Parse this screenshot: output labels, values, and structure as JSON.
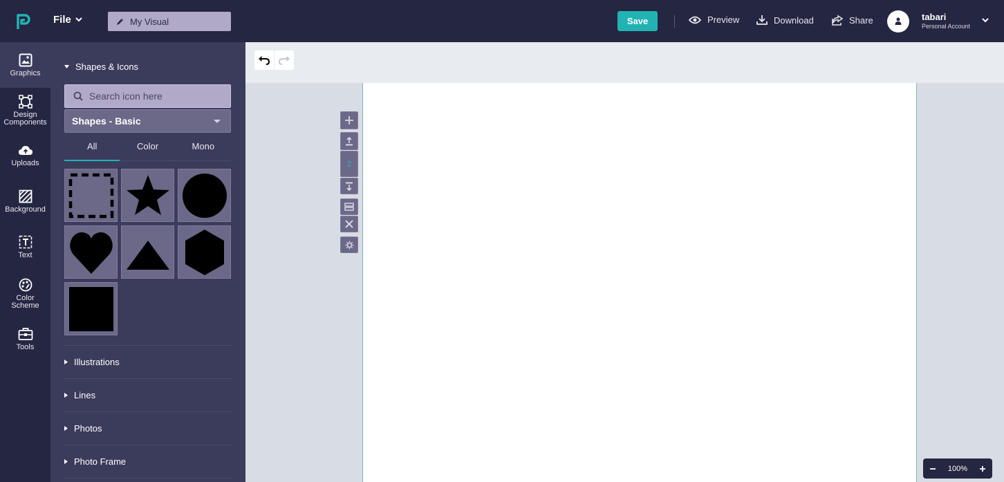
{
  "header": {
    "file_menu": "File",
    "document_title": "My Visual",
    "save_label": "Save",
    "preview_label": "Preview",
    "download_label": "Download",
    "share_label": "Share",
    "user_name": "tabari",
    "user_account": "Personal Account"
  },
  "rail": {
    "items": [
      {
        "label": "Graphics",
        "icon": "image-icon"
      },
      {
        "label": "Design Components",
        "icon": "components-icon"
      },
      {
        "label": "Uploads",
        "icon": "cloud-upload-icon"
      },
      {
        "label": "Background",
        "icon": "hatched-square-icon"
      },
      {
        "label": "Text",
        "icon": "text-box-icon"
      },
      {
        "label": "Color Scheme",
        "icon": "palette-icon"
      },
      {
        "label": "Tools",
        "icon": "toolbox-icon"
      }
    ]
  },
  "panel": {
    "section_title": "Shapes & Icons",
    "search_placeholder": "Search icon here",
    "category": "Shapes - Basic",
    "tabs": [
      "All",
      "Color",
      "Mono"
    ],
    "shapes": [
      "dashed-square",
      "star",
      "circle",
      "heart",
      "triangle",
      "hexagon",
      "square"
    ],
    "collapsed_sections": [
      "Illustrations",
      "Lines",
      "Photos",
      "Photo Frame"
    ]
  },
  "canvas": {
    "page_number": "2",
    "zoom": "100%"
  },
  "colors": {
    "topbar": "#252641",
    "panel": "#3b3b5c",
    "accent": "#21b3b4"
  }
}
